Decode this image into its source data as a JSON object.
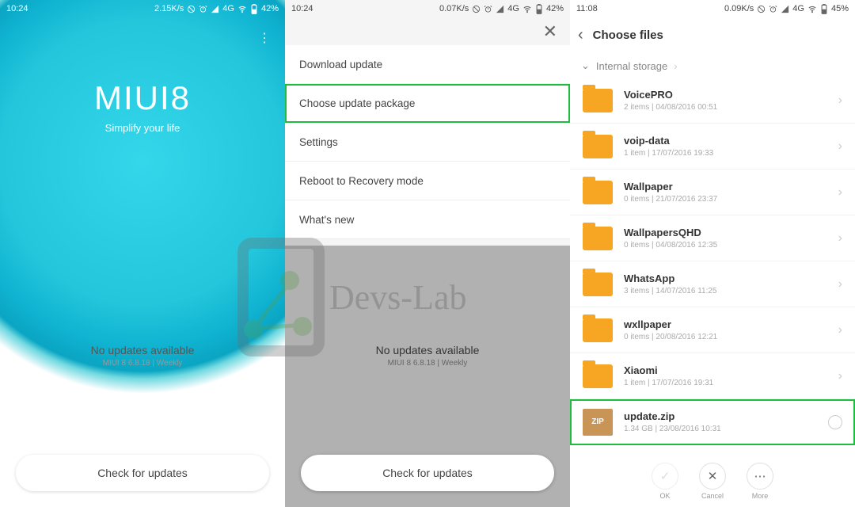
{
  "screen1": {
    "time": "10:24",
    "speed": "2.15K/s",
    "network": "4G",
    "battery": "42%",
    "logo_title": "MIUI8",
    "logo_subtitle": "Simplify your life",
    "noupdate_title": "No updates available",
    "noupdate_sub": "MIUI 8 6.8.18 | Weekly",
    "check_btn": "Check for updates"
  },
  "screen2": {
    "time": "10:24",
    "speed": "0.07K/s",
    "network": "4G",
    "battery": "42%",
    "menu": {
      "download": "Download update",
      "choose": "Choose update package",
      "settings": "Settings",
      "reboot": "Reboot to Recovery mode",
      "whatsnew": "What's new"
    },
    "noupdate_title": "No updates available",
    "noupdate_sub": "MIUI 8 6.8.18 | Weekly",
    "check_btn": "Check for updates"
  },
  "screen3": {
    "time": "11:08",
    "speed": "0.09K/s",
    "network": "4G",
    "battery": "45%",
    "title": "Choose files",
    "breadcrumb": "Internal storage",
    "files": [
      {
        "name": "VoicePRO",
        "meta": "2 items  |  04/08/2016 00:51"
      },
      {
        "name": "voip-data",
        "meta": "1 item  |  17/07/2016 19:33"
      },
      {
        "name": "Wallpaper",
        "meta": "0 items  |  21/07/2016 23:37"
      },
      {
        "name": "WallpapersQHD",
        "meta": "0 items  |  04/08/2016 12:35"
      },
      {
        "name": "WhatsApp",
        "meta": "3 items  |  14/07/2016 11:25"
      },
      {
        "name": "wxllpaper",
        "meta": "0 items  |  20/08/2016 12:21"
      },
      {
        "name": "Xiaomi",
        "meta": "1 item  |  17/07/2016 19:31"
      }
    ],
    "zip": {
      "badge": "ZIP",
      "name": "update.zip",
      "meta": "1.34 GB  |  23/08/2016 10:31"
    },
    "actions": {
      "ok": "OK",
      "cancel": "Cancel",
      "more": "More"
    }
  },
  "watermark": "Devs-Lab"
}
